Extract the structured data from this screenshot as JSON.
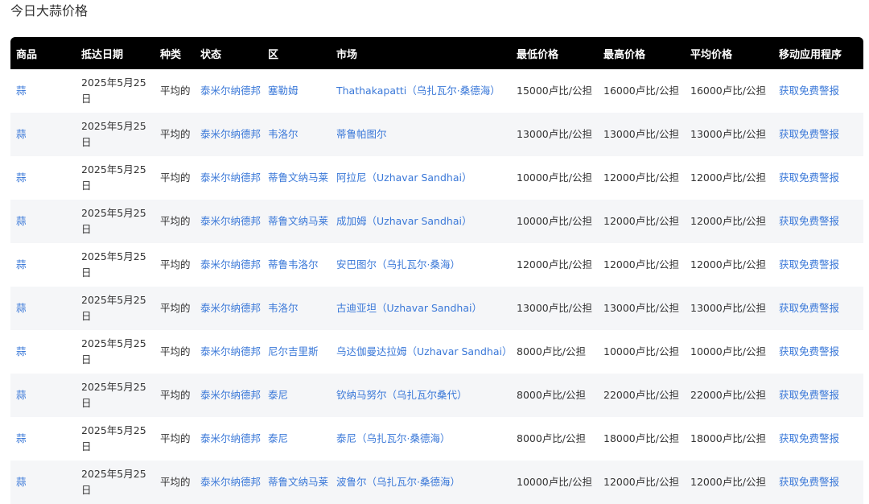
{
  "page": {
    "title": "今日大蒜价格"
  },
  "table": {
    "headers": [
      "商品",
      "抵达日期",
      "种类",
      "状态",
      "区",
      "市场",
      "最低价格",
      "最高价格",
      "平均价格",
      "移动应用程序"
    ],
    "rows": [
      {
        "commodity": "蒜",
        "date": "2025年5月25日",
        "variety": "平均的",
        "state": "泰米尔纳德邦",
        "district": "塞勒姆",
        "market": "Thathakapatti（乌扎瓦尔·桑德海）",
        "min": "15000卢比/公担",
        "max": "16000卢比/公担",
        "avg": "16000卢比/公担",
        "app": "获取免费警报"
      },
      {
        "commodity": "蒜",
        "date": "2025年5月25日",
        "variety": "平均的",
        "state": "泰米尔纳德邦",
        "district": "韦洛尔",
        "market": "蒂鲁帕图尔",
        "min": "13000卢比/公担",
        "max": "13000卢比/公担",
        "avg": "13000卢比/公担",
        "app": "获取免费警报"
      },
      {
        "commodity": "蒜",
        "date": "2025年5月25日",
        "variety": "平均的",
        "state": "泰米尔纳德邦",
        "district": "蒂鲁文纳马莱",
        "market": "阿拉尼（Uzhavar Sandhai）",
        "min": "10000卢比/公担",
        "max": "12000卢比/公担",
        "avg": "12000卢比/公担",
        "app": "获取免费警报"
      },
      {
        "commodity": "蒜",
        "date": "2025年5月25日",
        "variety": "平均的",
        "state": "泰米尔纳德邦",
        "district": "蒂鲁文纳马莱",
        "market": "成加姆（Uzhavar Sandhai）",
        "min": "10000卢比/公担",
        "max": "12000卢比/公担",
        "avg": "12000卢比/公担",
        "app": "获取免费警报"
      },
      {
        "commodity": "蒜",
        "date": "2025年5月25日",
        "variety": "平均的",
        "state": "泰米尔纳德邦",
        "district": "蒂鲁韦洛尔",
        "market": "安巴图尔（乌扎瓦尔·桑海）",
        "min": "12000卢比/公担",
        "max": "12000卢比/公担",
        "avg": "12000卢比/公担",
        "app": "获取免费警报"
      },
      {
        "commodity": "蒜",
        "date": "2025年5月25日",
        "variety": "平均的",
        "state": "泰米尔纳德邦",
        "district": "韦洛尔",
        "market": "古迪亚坦（Uzhavar Sandhai）",
        "min": "13000卢比/公担",
        "max": "13000卢比/公担",
        "avg": "13000卢比/公担",
        "app": "获取免费警报"
      },
      {
        "commodity": "蒜",
        "date": "2025年5月25日",
        "variety": "平均的",
        "state": "泰米尔纳德邦",
        "district": "尼尔吉里斯",
        "market": "乌达伽曼达拉姆（Uzhavar Sandhai）",
        "min": "8000卢比/公担",
        "max": "10000卢比/公担",
        "avg": "10000卢比/公担",
        "app": "获取免费警报"
      },
      {
        "commodity": "蒜",
        "date": "2025年5月25日",
        "variety": "平均的",
        "state": "泰米尔纳德邦",
        "district": "泰尼",
        "market": "钦纳马努尔（乌扎瓦尔桑代）",
        "min": "8000卢比/公担",
        "max": "22000卢比/公担",
        "avg": "22000卢比/公担",
        "app": "获取免费警报"
      },
      {
        "commodity": "蒜",
        "date": "2025年5月25日",
        "variety": "平均的",
        "state": "泰米尔纳德邦",
        "district": "泰尼",
        "market": "泰尼（乌扎瓦尔·桑德海）",
        "min": "8000卢比/公担",
        "max": "18000卢比/公担",
        "avg": "18000卢比/公担",
        "app": "获取免费警报"
      },
      {
        "commodity": "蒜",
        "date": "2025年5月25日",
        "variety": "平均的",
        "state": "泰米尔纳德邦",
        "district": "蒂鲁文纳马莱",
        "market": "波鲁尔（乌扎瓦尔·桑德海）",
        "min": "10000卢比/公担",
        "max": "12000卢比/公担",
        "avg": "12000卢比/公担",
        "app": "获取免费警报"
      }
    ]
  },
  "colors": {
    "link": "#3a78d8",
    "header_bg": "#000000",
    "stripe": "#f5f6f8"
  }
}
